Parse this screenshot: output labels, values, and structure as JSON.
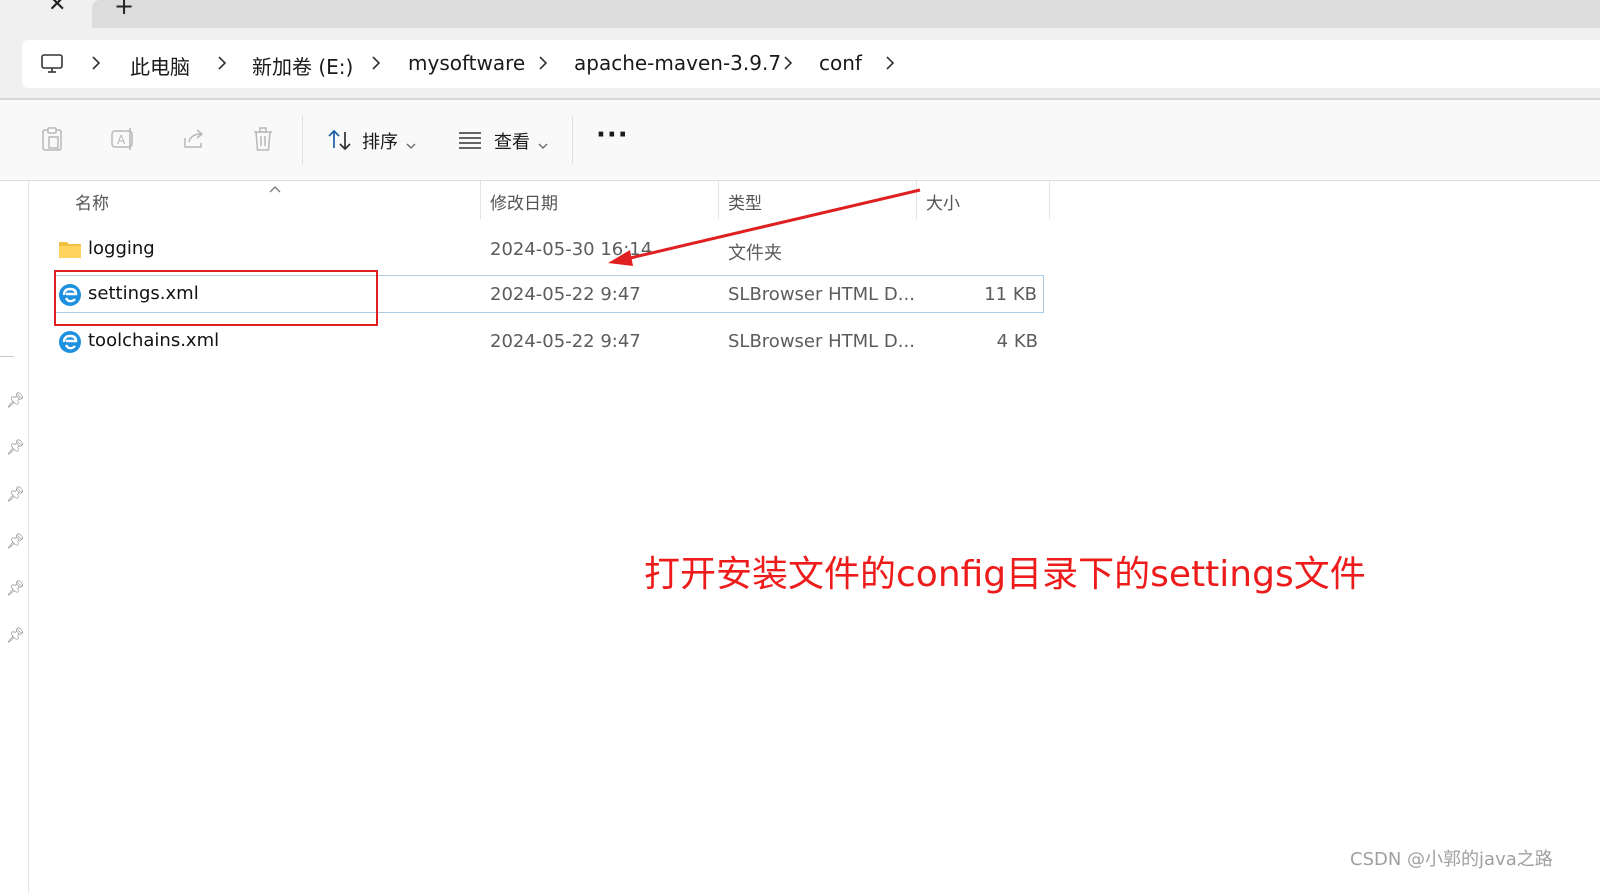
{
  "tabs": {
    "close_icon": "close-icon",
    "new_tab_icon": "plus-icon"
  },
  "breadcrumb": {
    "root_icon": "computer-icon",
    "items": [
      "此电脑",
      "新加卷 (E:)",
      "mysoftware",
      "apache-maven-3.9.7",
      "conf"
    ]
  },
  "toolbar": {
    "paste_icon": "clipboard-icon",
    "rename_icon": "rename-icon",
    "share_icon": "share-icon",
    "delete_icon": "trash-icon",
    "sort_label": "排序",
    "view_label": "查看",
    "more_label": "···"
  },
  "columns": {
    "name": "名称",
    "date": "修改日期",
    "type": "类型",
    "size": "大小"
  },
  "files": [
    {
      "name": "logging",
      "date": "2024-05-30 16:14",
      "type": "文件夹",
      "size": "",
      "icon": "folder-icon",
      "selected": false
    },
    {
      "name": "settings.xml",
      "date": "2024-05-22 9:47",
      "type": "SLBrowser HTML D...",
      "size": "11 KB",
      "icon": "browser-file-icon",
      "selected": true
    },
    {
      "name": "toolchains.xml",
      "date": "2024-05-22 9:47",
      "type": "SLBrowser HTML D...",
      "size": "4 KB",
      "icon": "browser-file-icon",
      "selected": false
    }
  ],
  "annotation": {
    "text": "打开安装文件的config目录下的settings文件",
    "color": "#ee1b1b"
  },
  "watermark": "CSDN @小郭的java之路",
  "colors": {
    "selection_border": "#a9cbe8",
    "folder": "#f3c043",
    "file_icon": "#1e90e0"
  }
}
